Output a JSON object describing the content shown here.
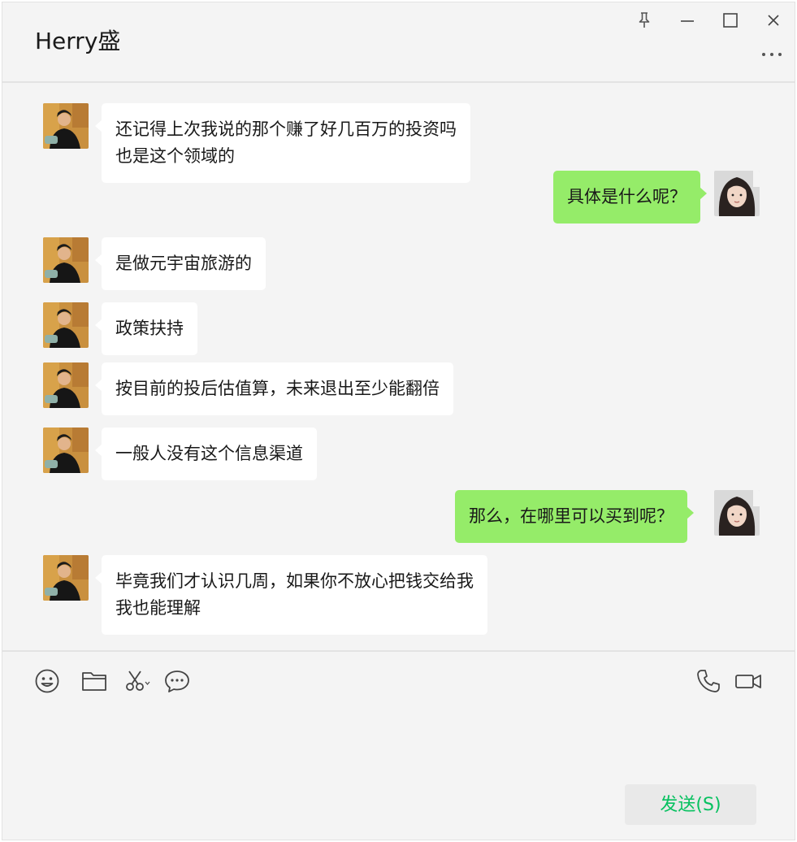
{
  "window": {
    "title": "Herry盛",
    "controls": [
      "pin-icon",
      "minimize-icon",
      "maximize-icon",
      "close-icon"
    ],
    "more_icon": "more-icon"
  },
  "messages": [
    {
      "side": "in",
      "text": "还记得上次我说的那个赚了好几百万的投资吗\n也是这个领域的"
    },
    {
      "side": "out",
      "text": "具体是什么呢？"
    },
    {
      "side": "in",
      "text": "是做元宇宙旅游的"
    },
    {
      "side": "in",
      "text": "政策扶持"
    },
    {
      "side": "in",
      "text": "按目前的投后估值算，未来退出至少能翻倍"
    },
    {
      "side": "in",
      "text": "一般人没有这个信息渠道"
    },
    {
      "side": "out",
      "text": "那么，在哪里可以买到呢？"
    },
    {
      "side": "in",
      "text": "毕竟我们才认识几周，如果你不放心把钱交给我\n我也能理解"
    }
  ],
  "toolbar": {
    "left_icons": [
      "emoji-icon",
      "folder-icon",
      "scissors-icon",
      "chat-bubble-icon"
    ],
    "right_icons": [
      "phone-icon",
      "video-icon"
    ]
  },
  "input": {
    "value": ""
  },
  "send_button": {
    "label": "发送(S)"
  },
  "colors": {
    "background": "#f4f4f4",
    "incoming_bubble": "#ffffff",
    "outgoing_bubble": "#95ec69",
    "send_text": "#07c160"
  }
}
